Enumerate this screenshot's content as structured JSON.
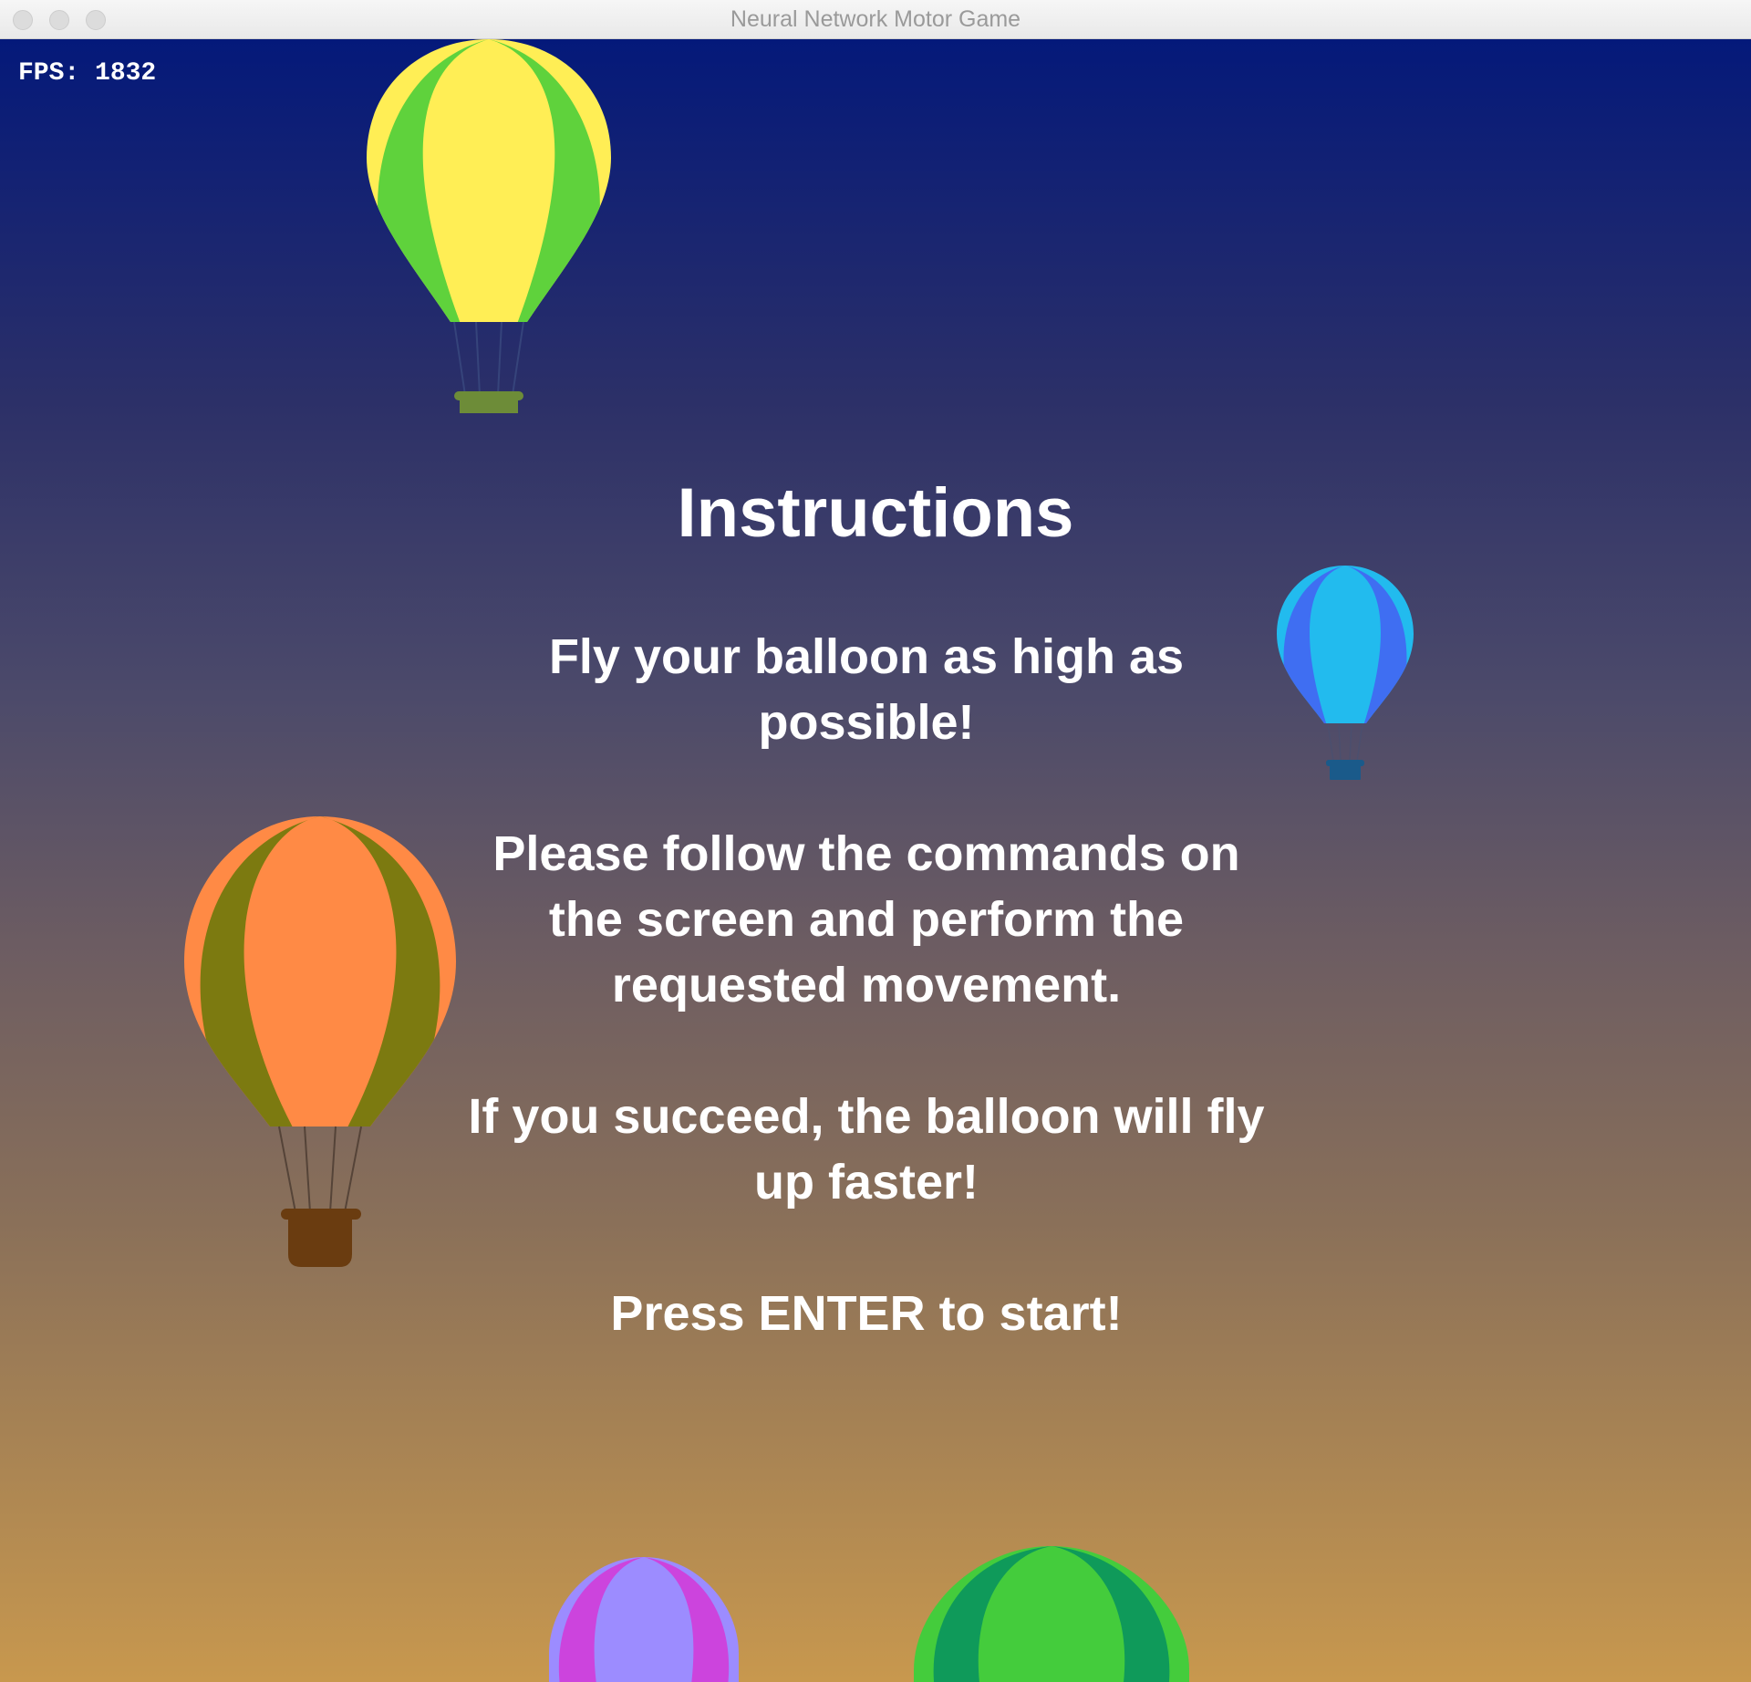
{
  "window": {
    "title": "Neural Network Motor Game"
  },
  "hud": {
    "fps_text": "FPS: 1832"
  },
  "instructions": {
    "title": "Instructions",
    "paragraphs": [
      "Fly your balloon as high as possible!",
      "Please follow the commands on the screen and perform the requested movement.",
      "If you succeed, the balloon will fly up faster!",
      "Press ENTER to start!"
    ]
  },
  "colors": {
    "sky_top": "#04197a",
    "sky_bottom": "#c8984e",
    "text": "#ffffff"
  },
  "balloons": [
    {
      "name": "yellow-green",
      "stripe_a": "#ffee55",
      "stripe_b": "#5fd23c",
      "basket": "#6d8c38"
    },
    {
      "name": "blue-cyan",
      "stripe_a": "#22bbee",
      "stripe_b": "#3f6ef2",
      "basket": "#1a5a8a"
    },
    {
      "name": "orange-olive",
      "stripe_a": "#ff8a45",
      "stripe_b": "#7c7a10",
      "basket": "#6a3c10"
    },
    {
      "name": "purple-magenta",
      "stripe_a": "#9c8cff",
      "stripe_b": "#cc44dd",
      "basket": "#5a2a7a"
    },
    {
      "name": "green-darkgreen",
      "stripe_a": "#44cc3c",
      "stripe_b": "#0f9a5a",
      "basket": "#1a5a2a"
    }
  ]
}
